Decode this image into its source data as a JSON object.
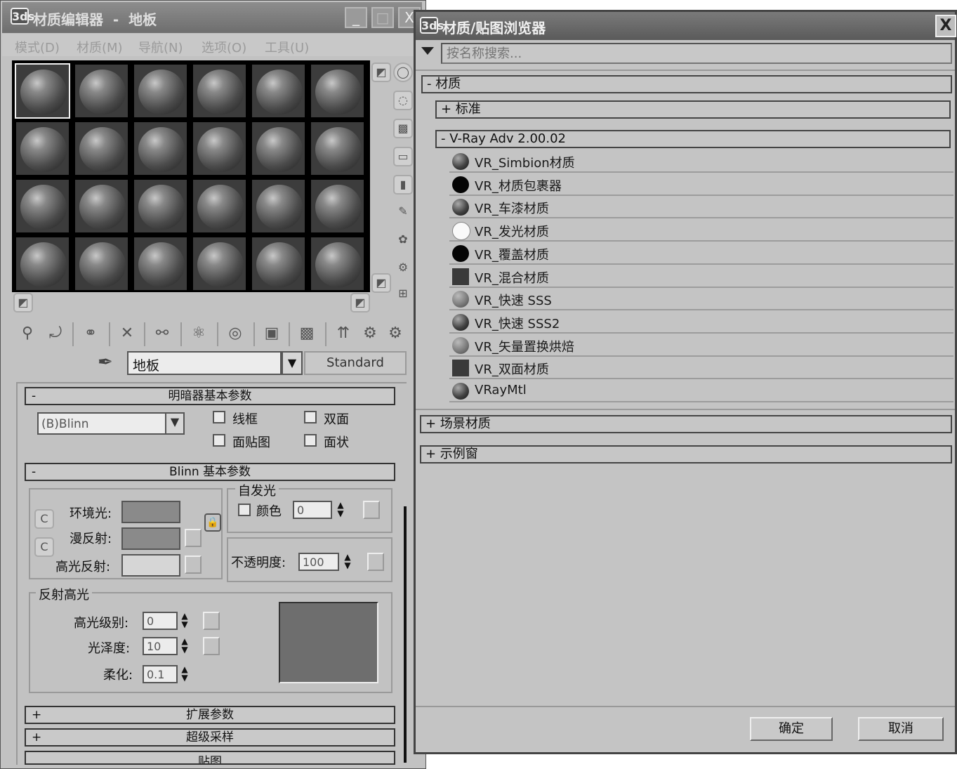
{
  "editor": {
    "title": "材质编辑器  -  地板",
    "app_icon": "3ds",
    "window_buttons": [
      "_",
      "□",
      "X"
    ],
    "menu": [
      "模式(D)",
      "材质(M)",
      "导航(N)",
      "选项(O)",
      "工具(U)"
    ],
    "slots": {
      "rows": 4,
      "cols": 6,
      "selected_index": 0
    },
    "material_name": "地板",
    "material_type": "Standard",
    "dropdown_glyph": "▼",
    "shader_rollout": {
      "title": "明暗器基本参数",
      "collapse": "-",
      "shader": "(B)Blinn",
      "options": [
        "线框",
        "双面",
        "面贴图",
        "面状"
      ]
    },
    "blinn_rollout": {
      "title": "Blinn 基本参数",
      "collapse": "-",
      "ambient_label": "环境光:",
      "diffuse_label": "漫反射:",
      "specular_label": "高光反射:",
      "lock_glyph": "C",
      "self_illum_title": "自发光",
      "color_label": "颜色",
      "self_illum_value": "0",
      "opacity_label": "不透明度:",
      "opacity_value": "100",
      "spec_title": "反射高光",
      "spec_level_label": "高光级别:",
      "spec_level_value": "0",
      "gloss_label": "光泽度:",
      "gloss_value": "10",
      "soften_label": "柔化:",
      "soften_value": "0.1"
    },
    "collapsed_rollouts": [
      "扩展参数",
      "超级采样",
      "贴图"
    ],
    "colors": {
      "ambient": "#8a8a8a",
      "diffuse": "#8a8a8a",
      "specular": "#d6d6d6",
      "highlight_preview": "#6e6e6e"
    }
  },
  "browser": {
    "title": "材质/贴图浏览器",
    "close": "X",
    "search_placeholder": "按名称搜索...",
    "categories": {
      "materials": "- 材质",
      "standard": "+ 标准",
      "vray": "- V-Ray Adv 2.00.02",
      "scene": "+ 场景材质",
      "sample": "+ 示例窗"
    },
    "vray_items": [
      {
        "name": "VR_Simbion材质",
        "icon": "dark-sphere"
      },
      {
        "name": "VR_材质包裹器",
        "icon": "black-sphere"
      },
      {
        "name": "VR_车漆材质",
        "icon": "dark-sphere"
      },
      {
        "name": "VR_发光材质",
        "icon": "white-sphere"
      },
      {
        "name": "VR_覆盖材质",
        "icon": "black-sphere"
      },
      {
        "name": "VR_混合材质",
        "icon": "dark-square"
      },
      {
        "name": "VR_快速 SSS",
        "icon": "grey-sphere"
      },
      {
        "name": "VR_快速 SSS2",
        "icon": "dark-sphere"
      },
      {
        "name": "VR_矢量置换烘焙",
        "icon": "grey-sphere"
      },
      {
        "name": "VR_双面材质",
        "icon": "dark-square"
      },
      {
        "name": "VRayMtl",
        "icon": "dark-sphere"
      }
    ],
    "ok_label": "确定",
    "cancel_label": "取消"
  }
}
